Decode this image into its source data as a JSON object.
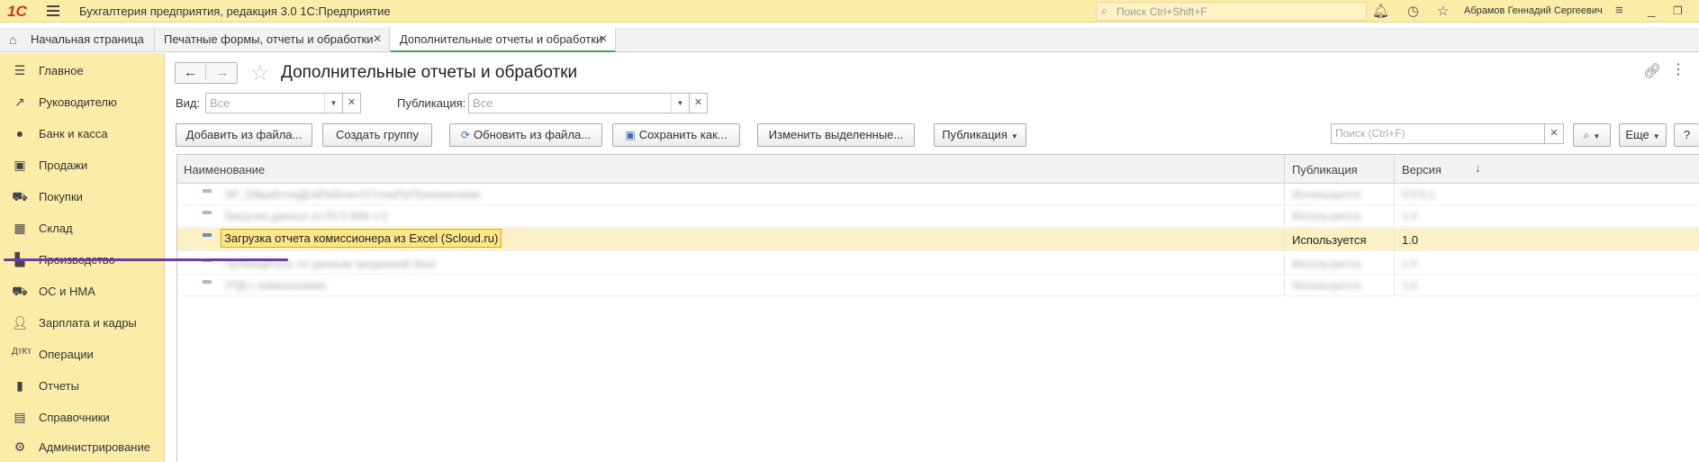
{
  "app": {
    "logo": "1С",
    "title": "Бухгалтерия предприятия, редакция 3.0 1С:Предприятие",
    "search_placeholder": "Поиск Ctrl+Shift+F",
    "user": "Абрамов Геннадий Сергеевич"
  },
  "tabs": [
    {
      "label": "Начальная страница"
    },
    {
      "label": "Печатные формы, отчеты и обработки"
    },
    {
      "label": "Дополнительные отчеты и обработки",
      "active": true
    }
  ],
  "sidebar": {
    "items": [
      {
        "label": "Главное",
        "icon": "menu-icon"
      },
      {
        "label": "Руководителю",
        "icon": "trend-icon"
      },
      {
        "label": "Банк и касса",
        "icon": "coin-icon"
      },
      {
        "label": "Продажи",
        "icon": "bag-icon"
      },
      {
        "label": "Покупки",
        "icon": "cart-icon"
      },
      {
        "label": "Склад",
        "icon": "warehouse-icon"
      },
      {
        "label": "Производство",
        "icon": "factory-icon"
      },
      {
        "label": "ОС и НМА",
        "icon": "truck-icon"
      },
      {
        "label": "Зарплата и кадры",
        "icon": "person-icon"
      },
      {
        "label": "Операции",
        "icon": "dt-kt-icon"
      },
      {
        "label": "Отчеты",
        "icon": "bar-chart-icon"
      },
      {
        "label": "Справочники",
        "icon": "book-icon"
      },
      {
        "label": "Администрирование",
        "icon": "gear-icon"
      }
    ]
  },
  "page": {
    "title": "Дополнительные отчеты и обработки",
    "filters": {
      "vid_label": "Вид:",
      "vid_placeholder": "Все",
      "pub_label": "Публикация:",
      "pub_placeholder": "Все"
    },
    "toolbar": {
      "add_from_file": "Добавить из файла...",
      "create_group": "Создать группу",
      "update_from_file": "Обновить из файла...",
      "save_as": "Сохранить как...",
      "change_selected": "Изменить выделенные...",
      "publication": "Публикация",
      "search_placeholder": "Поиск (Ctrl+F)",
      "more": "Еще",
      "help": "?"
    },
    "table": {
      "columns": [
        "Наименование",
        "Публикация",
        "Версия"
      ],
      "rows": [
        {
          "name": "ЭР_ОбработкаДляРабочегоСтолаПоПолномочиям",
          "publication": "Используется",
          "version": "0.0.0.1",
          "blurred": true
        },
        {
          "name": "Загрузка данных из PCS Bills v.2",
          "publication": "Используется",
          "version": "1.0",
          "blurred": true
        },
        {
          "name": "Загрузка отчета комиссионера из Excel (Scloud.ru)",
          "publication": "Используется",
          "version": "1.0",
          "selected": true
        },
        {
          "name": "Путеводитель по данным продажной базе",
          "publication": "Используется",
          "version": "1.0",
          "blurred": true
        },
        {
          "name": "УПД с изменениями",
          "publication": "Используется",
          "version": "1.0",
          "blurred": true
        }
      ]
    }
  }
}
